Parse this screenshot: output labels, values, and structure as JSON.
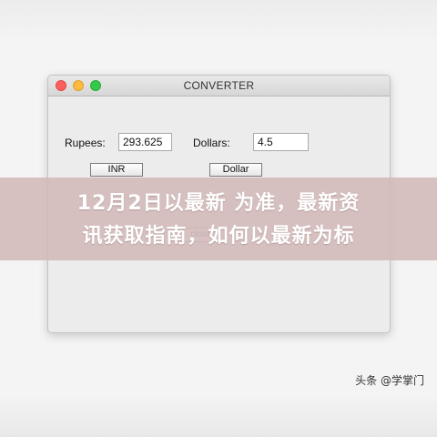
{
  "window": {
    "title": "CONVERTER",
    "rupees_label": "Rupees:",
    "rupees_value": "293.625",
    "dollars_label": "Dollars:",
    "dollars_value": "4.5",
    "inr_button": "INR",
    "dollar_button": "Dollar",
    "close_button": "close"
  },
  "banner": {
    "line1": "12月2日以最新 为准，最新资",
    "line2": "讯获取指南，如何以最新为标"
  },
  "watermark": {
    "text": "头条 @学掌门"
  },
  "colors": {
    "traffic_close": "#fc605c",
    "traffic_minimize": "#fdbc40",
    "traffic_maximize": "#34c84a",
    "banner": "#d1bab8"
  }
}
